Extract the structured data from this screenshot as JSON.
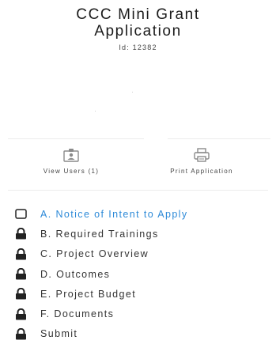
{
  "header": {
    "title_line1": "CCC Mini Grant",
    "title_line2": "Application",
    "id_text": "Id: 12382"
  },
  "actions": {
    "view_users_label": "View Users (1)",
    "print_label": "Print Application"
  },
  "steps": [
    {
      "label": "A. Notice of Intent to Apply",
      "state": "open"
    },
    {
      "label": "B. Required Trainings",
      "state": "locked"
    },
    {
      "label": "C. Project Overview",
      "state": "locked"
    },
    {
      "label": "D. Outcomes",
      "state": "locked"
    },
    {
      "label": "E. Project Budget",
      "state": "locked"
    },
    {
      "label": "F. Documents",
      "state": "locked"
    },
    {
      "label": "Submit",
      "state": "locked"
    }
  ],
  "colors": {
    "active_link": "#2d8ad8",
    "text": "#333333",
    "divider": "#ececec"
  },
  "icons": {
    "view_users": "users-card-icon",
    "print": "printer-icon",
    "open_step": "empty-checkbox-icon",
    "locked_step": "lock-icon"
  }
}
